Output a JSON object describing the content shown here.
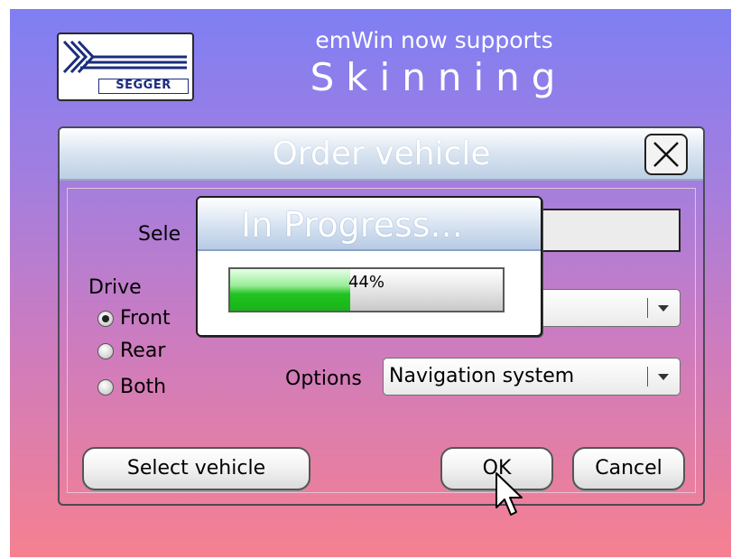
{
  "logo": {
    "text": "SEGGER"
  },
  "headline": {
    "line1": "emWin now supports",
    "line2": "Skinning"
  },
  "order_window": {
    "title": "Order vehicle",
    "close_icon": "close-x-icon",
    "select_label": "Sele",
    "drive_label": "Drive",
    "drive_options": [
      "Front",
      "Rear",
      "Both"
    ],
    "drive_selected": "Front",
    "options_label": "Options",
    "options_value": "Navigation system",
    "drive_dropdown_value": "",
    "select_button": "Select vehicle",
    "ok_button": "OK",
    "cancel_button": "Cancel"
  },
  "progress_dialog": {
    "title": "In Progress...",
    "progress_value": 0.44,
    "progress_text": "44%"
  },
  "colors": {
    "background_top": "#7f7ff3",
    "background_bottom": "#f68090",
    "progress_fill": "#22c322",
    "title_text": "#ffffff"
  },
  "icons": {
    "logo": "segger-logo-icon",
    "close": "close-x-icon",
    "dropdown": "chevron-down-icon",
    "cursor": "mouse-pointer-icon"
  }
}
